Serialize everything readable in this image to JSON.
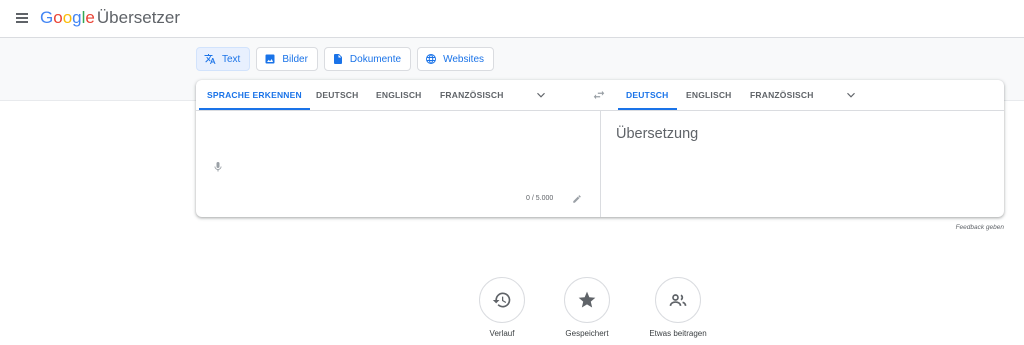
{
  "header": {
    "logo_parts": [
      {
        "text": "G",
        "color": "#4285F4"
      },
      {
        "text": "o",
        "color": "#EA4335"
      },
      {
        "text": "o",
        "color": "#FBBC05"
      },
      {
        "text": "g",
        "color": "#4285F4"
      },
      {
        "text": "l",
        "color": "#34A853"
      },
      {
        "text": "e",
        "color": "#EA4335"
      }
    ],
    "product_name": "Übersetzer"
  },
  "mode_tabs": [
    {
      "label": "Text",
      "icon": "translate-icon",
      "active": true
    },
    {
      "label": "Bilder",
      "icon": "image-icon",
      "active": false
    },
    {
      "label": "Dokumente",
      "icon": "document-icon",
      "active": false
    },
    {
      "label": "Websites",
      "icon": "globe-icon",
      "active": false
    }
  ],
  "source_languages": [
    "SPRACHE ERKENNEN",
    "DEUTSCH",
    "ENGLISCH",
    "FRANZÖSISCH"
  ],
  "source_selected": "SPRACHE ERKENNEN",
  "target_languages": [
    "DEUTSCH",
    "ENGLISCH",
    "FRANZÖSISCH"
  ],
  "target_selected": "DEUTSCH",
  "source_panel": {
    "counter": "0 / 5.000"
  },
  "target_panel": {
    "placeholder": "Übersetzung"
  },
  "feedback": "Feedback geben",
  "actions": [
    {
      "label": "Verlauf",
      "icon": "history-icon"
    },
    {
      "label": "Gespeichert",
      "icon": "star-icon"
    },
    {
      "label": "Etwas beitragen",
      "icon": "community-icon"
    }
  ],
  "colors": {
    "accent": "#1a73e8",
    "muted": "#5f6368",
    "border": "#dadce0"
  }
}
